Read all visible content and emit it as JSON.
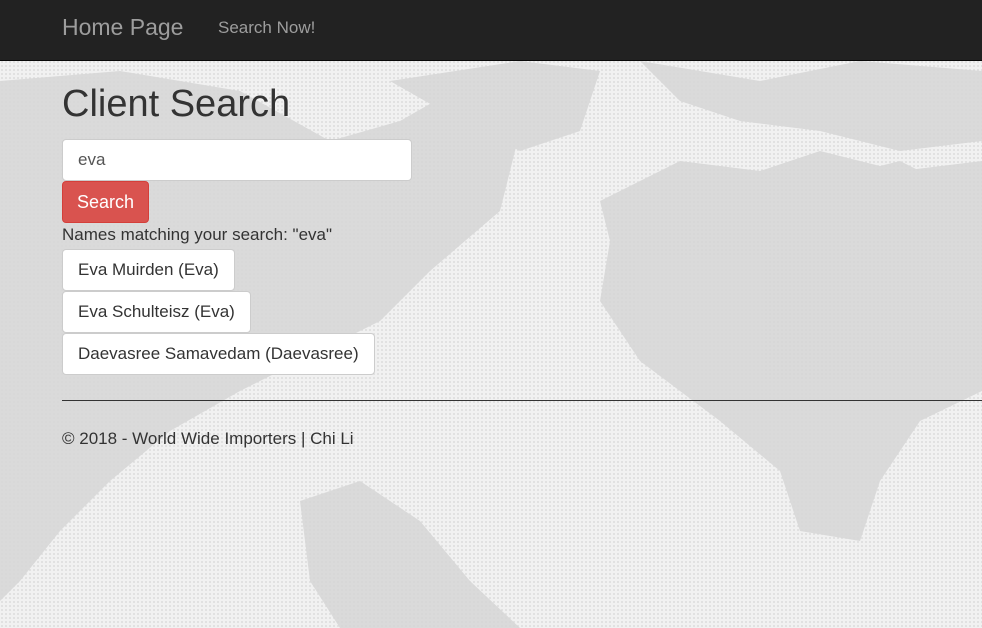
{
  "navbar": {
    "brand": "Home Page",
    "search_link": "Search Now!"
  },
  "main": {
    "title": "Client Search",
    "search_input_value": "eva",
    "search_button": "Search",
    "results_label": "Names matching your search: \"eva\"",
    "results": [
      "Eva Muirden (Eva)",
      "Eva Schulteisz (Eva)",
      "Daevasree Samavedam (Daevasree)"
    ]
  },
  "footer": {
    "text": "© 2018 - World Wide Importers | Chi Li"
  },
  "colors": {
    "navbar_bg": "#222222",
    "navbar_text": "#9d9d9d",
    "danger_button": "#d9534f",
    "page_text": "#333333"
  }
}
